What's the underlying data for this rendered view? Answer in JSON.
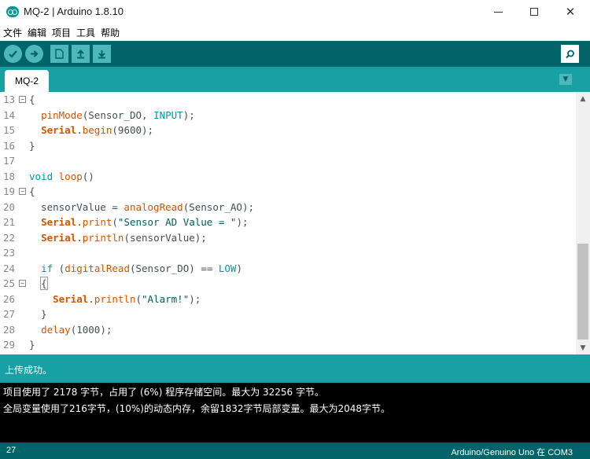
{
  "window": {
    "title": "MQ-2 | Arduino 1.8.10"
  },
  "menu": [
    "文件",
    "编辑",
    "项目",
    "工具",
    "帮助"
  ],
  "toolbar": {
    "verify_icon": "checkmark-icon",
    "upload_icon": "arrow-right-icon",
    "new_icon": "new-file-icon",
    "open_icon": "open-arrow-up-icon",
    "save_icon": "save-arrow-down-icon",
    "serial_monitor_icon": "magnifier-icon"
  },
  "tab": {
    "label": "MQ-2"
  },
  "editor": {
    "lines": [
      {
        "n": "13",
        "fold": "⊟",
        "code": "{"
      },
      {
        "n": "14",
        "fold": "",
        "code": "  pinMode(Sensor_DO, INPUT);"
      },
      {
        "n": "15",
        "fold": "",
        "code": "  Serial.begin(9600);"
      },
      {
        "n": "16",
        "fold": "",
        "code": "}"
      },
      {
        "n": "17",
        "fold": "",
        "code": ""
      },
      {
        "n": "18",
        "fold": "",
        "code": "void loop()"
      },
      {
        "n": "19",
        "fold": "⊟",
        "code": "{"
      },
      {
        "n": "20",
        "fold": "",
        "code": "  sensorValue = analogRead(Sensor_AO);"
      },
      {
        "n": "21",
        "fold": "",
        "code": "  Serial.print(\"Sensor AD Value = \");"
      },
      {
        "n": "22",
        "fold": "",
        "code": "  Serial.println(sensorValue);"
      },
      {
        "n": "23",
        "fold": "",
        "code": ""
      },
      {
        "n": "24",
        "fold": "",
        "code": "  if (digitalRead(Sensor_DO) == LOW)"
      },
      {
        "n": "25",
        "fold": "⊟",
        "code": "  {"
      },
      {
        "n": "26",
        "fold": "",
        "code": "    Serial.println(\"Alarm!\");"
      },
      {
        "n": "27",
        "fold": "",
        "code": "  }"
      },
      {
        "n": "28",
        "fold": "",
        "code": "  delay(1000);"
      },
      {
        "n": "29",
        "fold": "",
        "code": "}"
      }
    ]
  },
  "status": {
    "message": "上传成功。"
  },
  "console": {
    "lines": [
      "项目使用了 2178 字节，占用了 (6%) 程序存储空间。最大为 32256 字节。",
      "全局变量使用了216字节，(10%)的动态内存，余留1832字节局部变量。最大为2048字节。"
    ]
  },
  "footer": {
    "line_number": "27",
    "board": "Arduino/Genuino Uno 在 COM3"
  },
  "colors": {
    "toolbar": "#006468",
    "tabbar": "#17a1a5",
    "button": "#4db7bb",
    "console": "#000000"
  }
}
